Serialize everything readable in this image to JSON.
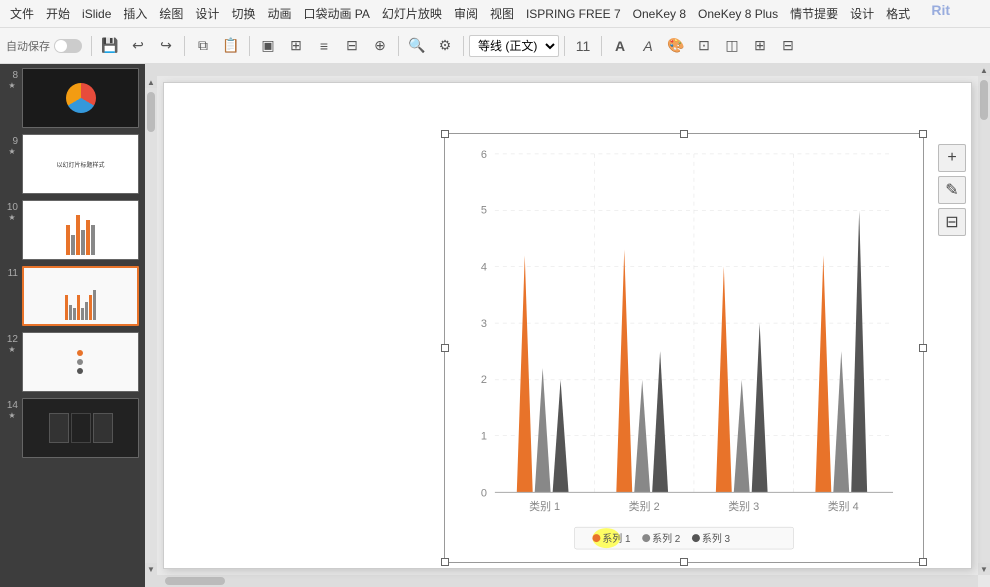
{
  "menubar": {
    "items": [
      "文件",
      "开始",
      "iSlide",
      "插入",
      "绘图",
      "设计",
      "切换",
      "动画",
      "口袋动画 PA",
      "幻灯片放映",
      "审阅",
      "视图",
      "ISPRING FREE 7",
      "OneKey 8",
      "OneKey 8 Plus",
      "情节提要",
      "设计",
      "格式"
    ]
  },
  "toolbar": {
    "autosave_label": "自动保存",
    "line_style_label": "等线 (正文)",
    "font_size": "11"
  },
  "slides": [
    {
      "num": "8",
      "star": "★",
      "active": false
    },
    {
      "num": "9",
      "star": "★",
      "active": false
    },
    {
      "num": "10",
      "star": "★",
      "active": false
    },
    {
      "num": "11",
      "star": "",
      "active": true
    },
    {
      "num": "12",
      "star": "★",
      "active": false
    },
    {
      "num": "14",
      "star": "★",
      "active": false
    }
  ],
  "chart": {
    "title": "",
    "y_axis": {
      "max": 6,
      "values": [
        "0",
        "1",
        "2",
        "3",
        "4",
        "5",
        "6"
      ]
    },
    "categories": [
      "类别 1",
      "类别 2",
      "类别 3",
      "类别 4"
    ],
    "series": [
      {
        "name": "系列 1",
        "color": "#e8732a",
        "values": [
          4.2,
          4.3,
          4.0,
          4.2
        ]
      },
      {
        "name": "系列 2",
        "color": "#888888",
        "values": [
          2.2,
          2.0,
          2.0,
          2.5
        ]
      },
      {
        "name": "系列 3",
        "color": "#555555",
        "values": [
          2.0,
          2.5,
          3.0,
          5.0
        ]
      }
    ],
    "legend": {
      "series1": "系列 1",
      "series2": "系列 2",
      "series3": "系列 3"
    }
  },
  "right_panel": {
    "add_btn": "+",
    "pen_btn": "✎",
    "filter_btn": "⊟"
  },
  "watermark": "Rit"
}
